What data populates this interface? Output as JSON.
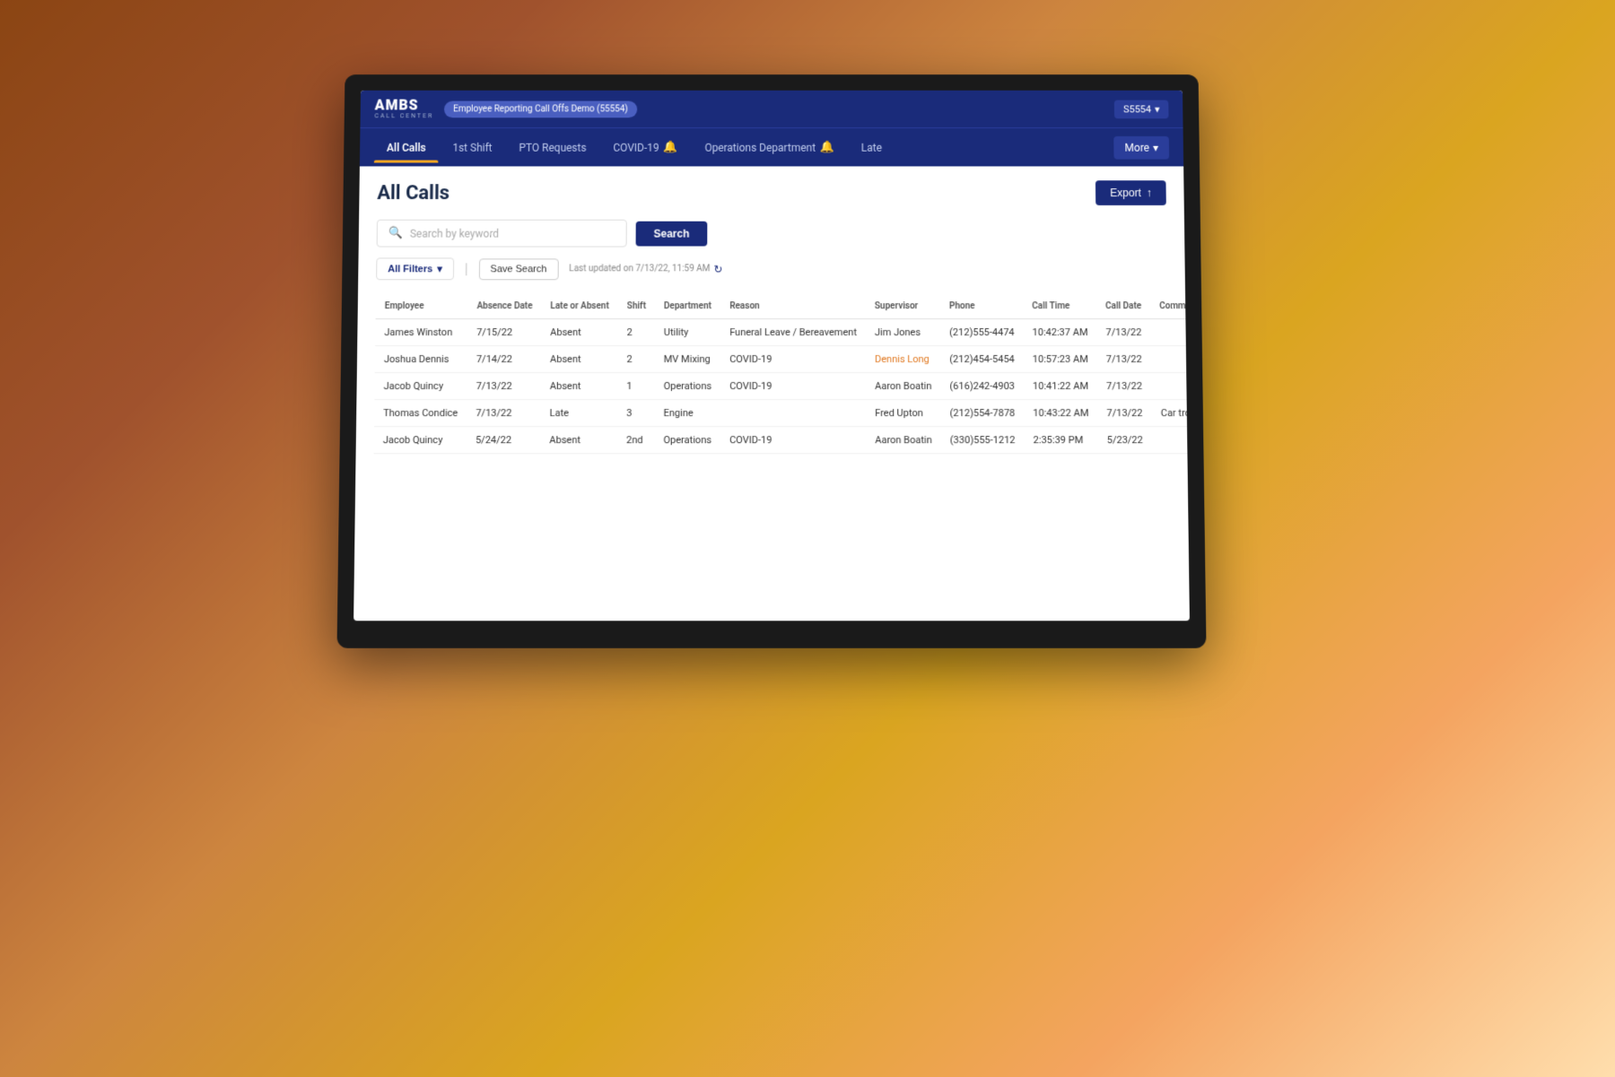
{
  "background": {
    "color": "#7a5c2a"
  },
  "app": {
    "logo": {
      "main": "AMBS",
      "sub": "CALL CENTER"
    },
    "demo_badge": "Employee Reporting Call Offs Demo (55554)",
    "user_badge": "S5554",
    "user_dropdown_icon": "▾"
  },
  "nav": {
    "items": [
      {
        "label": "All Calls",
        "active": true
      },
      {
        "label": "1st Shift",
        "active": false
      },
      {
        "label": "PTO Requests",
        "active": false
      },
      {
        "label": "COVID-19",
        "active": false,
        "bell": true
      },
      {
        "label": "Operations Department",
        "active": false,
        "bell": true
      },
      {
        "label": "Late",
        "active": false
      }
    ],
    "more_label": "More",
    "more_dropdown_icon": "▾"
  },
  "page": {
    "title": "All Calls",
    "export_label": "Export",
    "export_icon": "↑"
  },
  "search": {
    "placeholder": "Search by keyword",
    "button_label": "Search",
    "all_filters_label": "All Filters",
    "save_search_label": "Save Search",
    "last_updated": "Last updated on 7/13/22, 11:59 AM",
    "refresh_icon": "↻"
  },
  "table": {
    "columns": [
      "Employee",
      "Absence Date",
      "Late or Absent",
      "Shift",
      "Department",
      "Reason",
      "Supervisor",
      "Phone",
      "Call Time",
      "Call Date",
      "Comments"
    ],
    "rows": [
      {
        "employee": "James Winston",
        "absence_date": "7/15/22",
        "late_or_absent": "Absent",
        "shift": "2",
        "department": "Utility",
        "reason": "Funeral Leave / Bereavement",
        "supervisor": "Jim Jones",
        "supervisor_link": false,
        "phone": "(212)555-4474",
        "call_time": "10:42:37 AM",
        "call_date": "7/13/22",
        "comments": ""
      },
      {
        "employee": "Joshua Dennis",
        "absence_date": "7/14/22",
        "late_or_absent": "Absent",
        "shift": "2",
        "department": "MV Mixing",
        "reason": "COVID-19",
        "supervisor": "Dennis Long",
        "supervisor_link": true,
        "phone": "(212)454-5454",
        "call_time": "10:57:23 AM",
        "call_date": "7/13/22",
        "comments": ""
      },
      {
        "employee": "Jacob Quincy",
        "absence_date": "7/13/22",
        "late_or_absent": "Absent",
        "shift": "1",
        "department": "Operations",
        "reason": "COVID-19",
        "supervisor": "Aaron Boatin",
        "supervisor_link": false,
        "phone": "(616)242-4903",
        "call_time": "10:41:22 AM",
        "call_date": "7/13/22",
        "comments": ""
      },
      {
        "employee": "Thomas Condice",
        "absence_date": "7/13/22",
        "late_or_absent": "Late",
        "shift": "3",
        "department": "Engine",
        "reason": "",
        "supervisor": "Fred Upton",
        "supervisor_link": false,
        "phone": "(212)554-7878",
        "call_time": "10:43:22 AM",
        "call_date": "7/13/22",
        "comments": "Car trouble"
      },
      {
        "employee": "Jacob Quincy",
        "absence_date": "5/24/22",
        "late_or_absent": "Absent",
        "shift": "2nd",
        "department": "Operations",
        "reason": "COVID-19",
        "supervisor": "Aaron Boatin",
        "supervisor_link": false,
        "phone": "(330)555-1212",
        "call_time": "2:35:39 PM",
        "call_date": "5/23/22",
        "comments": ""
      }
    ]
  }
}
